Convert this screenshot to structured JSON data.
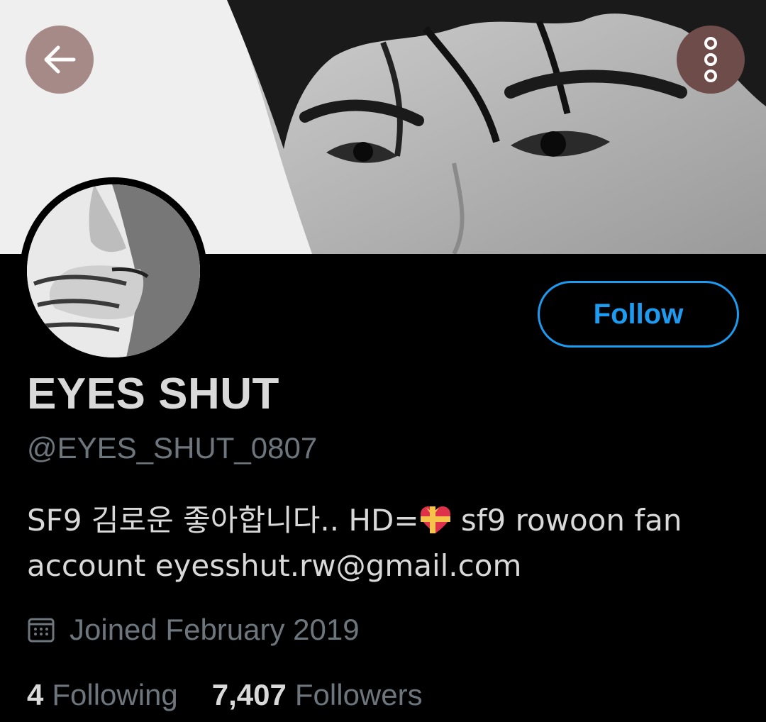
{
  "header": {
    "back_icon": "arrow-left-icon",
    "more_icon": "vertical-ellipsis-icon",
    "back_bg": "#a58a87",
    "more_bg": "#6e4c49"
  },
  "profile": {
    "display_name": "EYES SHUT",
    "handle": "@EYES_SHUT_0807",
    "bio_line1_prefix": "SF9 김로운 좋아합니다.. HD=",
    "bio_line1_suffix": " sf9 rowoon fan",
    "bio_line2_prefix": "account  ",
    "bio_email": "eyesshut.rw@gmail.com",
    "bio_emoji": "heart-with-ribbon-icon",
    "joined": "Joined February 2019",
    "joined_icon": "calendar-icon"
  },
  "actions": {
    "follow_label": "Follow"
  },
  "stats": {
    "following_count": "4",
    "following_label": "Following",
    "followers_count": "7,407",
    "followers_label": "Followers"
  },
  "colors": {
    "accent": "#1d9bf0",
    "background": "#000000",
    "primary_text": "#d9d9d9",
    "secondary_text": "#6e767d"
  }
}
